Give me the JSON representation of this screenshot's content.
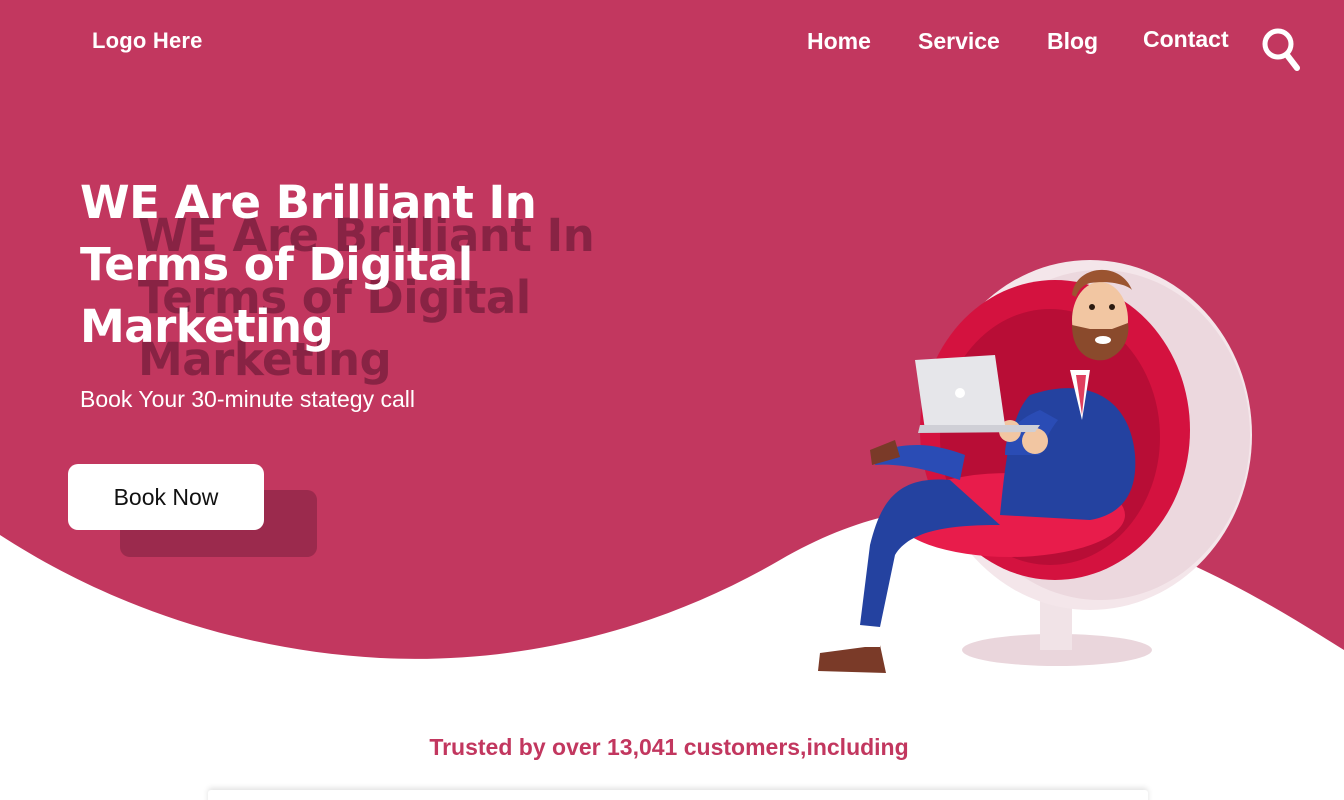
{
  "brand": {
    "logo_text": "Logo Here",
    "primary_color": "#c2375f",
    "shadow_color": "#9b2a4d"
  },
  "nav": {
    "items": [
      {
        "label": "Home"
      },
      {
        "label": "Service"
      },
      {
        "label": "Blog"
      },
      {
        "label": "Contact"
      }
    ],
    "search_icon": "search-icon"
  },
  "hero": {
    "headline": "WE Are Brilliant In Terms of Digital Marketing",
    "subtitle": "Book Your 30-minute stategy call",
    "cta_label": "Book Now",
    "illustration": "man-on-laptop-in-egg-chair"
  },
  "trust": {
    "text": "Trusted by over 13,041 customers,including"
  }
}
